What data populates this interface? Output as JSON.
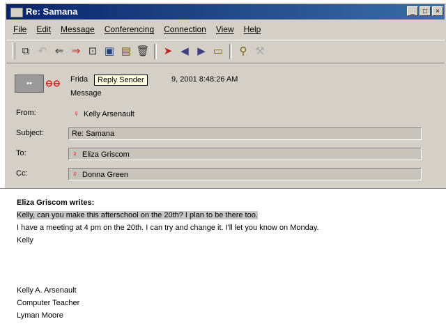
{
  "window": {
    "title": "Re: Samana"
  },
  "title_buttons": [
    "_",
    "□",
    "×"
  ],
  "menu": [
    "File",
    "Edit",
    "Message",
    "Conferencing",
    "Connection",
    "View",
    "Help"
  ],
  "toolbar_icons": [
    "new-message-icon",
    "reply-icon",
    "reply-all-icon",
    "forward-icon",
    "attach-icon",
    "save-icon",
    "print-icon",
    "delete-icon",
    "flag-icon",
    "previous-icon",
    "next-icon",
    "folder-icon",
    "search-icon",
    "tools-icon"
  ],
  "header": {
    "date_prefix": "Frida",
    "date_suffix": "9, 2001 8:48:26 AM",
    "tooltip": "Reply Sender",
    "message_type": "Message",
    "from_label": "From:",
    "from_value": "Kelly Arsenault",
    "subject_label": "Subject:",
    "subject_value": "Re: Samana",
    "to_label": "To:",
    "to_value": "Eliza Griscom",
    "cc_label": "Cc:",
    "cc_value": "Donna Green"
  },
  "body": {
    "quote_header": "Eliza Griscom writes:",
    "quoted_line": "Kelly, can you make this afterschool on the 20th? I plan to be there too.",
    "reply_line": "I have a meeting at 4 pm on the 20th. I can try and change it. I'll let you know on Monday.",
    "signoff": "Kelly",
    "signature": [
      "Kelly A. Arsenault",
      "Computer Teacher",
      "Lyman Moore"
    ]
  }
}
